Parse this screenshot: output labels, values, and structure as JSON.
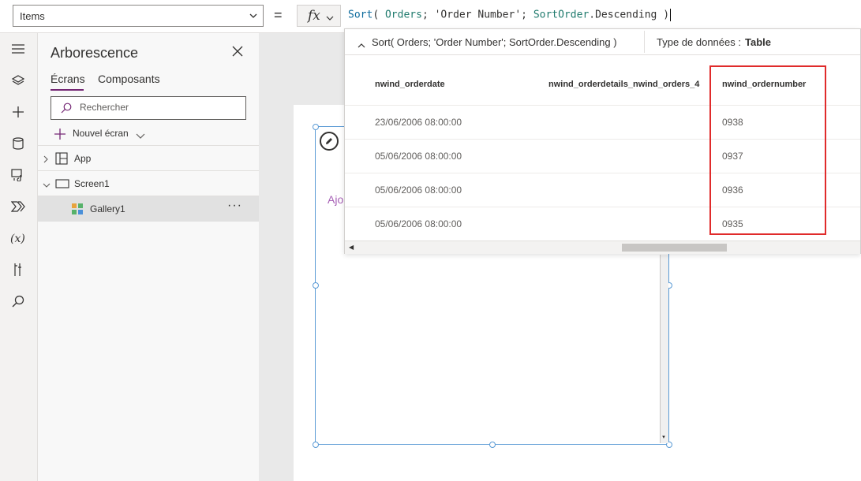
{
  "formula_bar": {
    "property": "Items",
    "equals": "=",
    "fx": "fx",
    "formula_parts": [
      "Sort",
      "( ",
      "Orders",
      "; ",
      "'Order Number'",
      "; ",
      "SortOrder",
      ".Descending ",
      ")"
    ]
  },
  "tree": {
    "title": "Arborescence",
    "tabs": [
      {
        "label": "Écrans"
      },
      {
        "label": "Composants"
      }
    ],
    "search_placeholder": "Rechercher",
    "new_screen_label": "Nouvel écran",
    "nodes": [
      {
        "label": "App"
      },
      {
        "label": "Screen1"
      },
      {
        "label": "Gallery1"
      }
    ],
    "more": "···"
  },
  "results": {
    "expression": "Sort( Orders; 'Order Number'; SortOrder.Descending )",
    "type_label": "Type de données :",
    "type_value": "Table",
    "columns": [
      "nwind_orderdate",
      "nwind_orderdetails_nwind_orders_4",
      "nwind_ordernumber"
    ],
    "rows": [
      [
        "23/06/2006 08:00:00",
        "",
        "0938"
      ],
      [
        "05/06/2006 08:00:00",
        "",
        "0937"
      ],
      [
        "05/06/2006 08:00:00",
        "",
        "0936"
      ],
      [
        "05/06/2006 08:00:00",
        "",
        "0935"
      ]
    ]
  },
  "canvas": {
    "gallery_placeholder": "Ajo"
  },
  "colors": {
    "accent": "#742774",
    "selection": "#5b9bd5",
    "highlight": "#e02b2b"
  },
  "icons": [
    "hamburger-icon",
    "layers-icon",
    "plus-icon",
    "database-icon",
    "media-icon",
    "power-automate-icon",
    "variables-icon",
    "tools-icon",
    "search-icon"
  ]
}
